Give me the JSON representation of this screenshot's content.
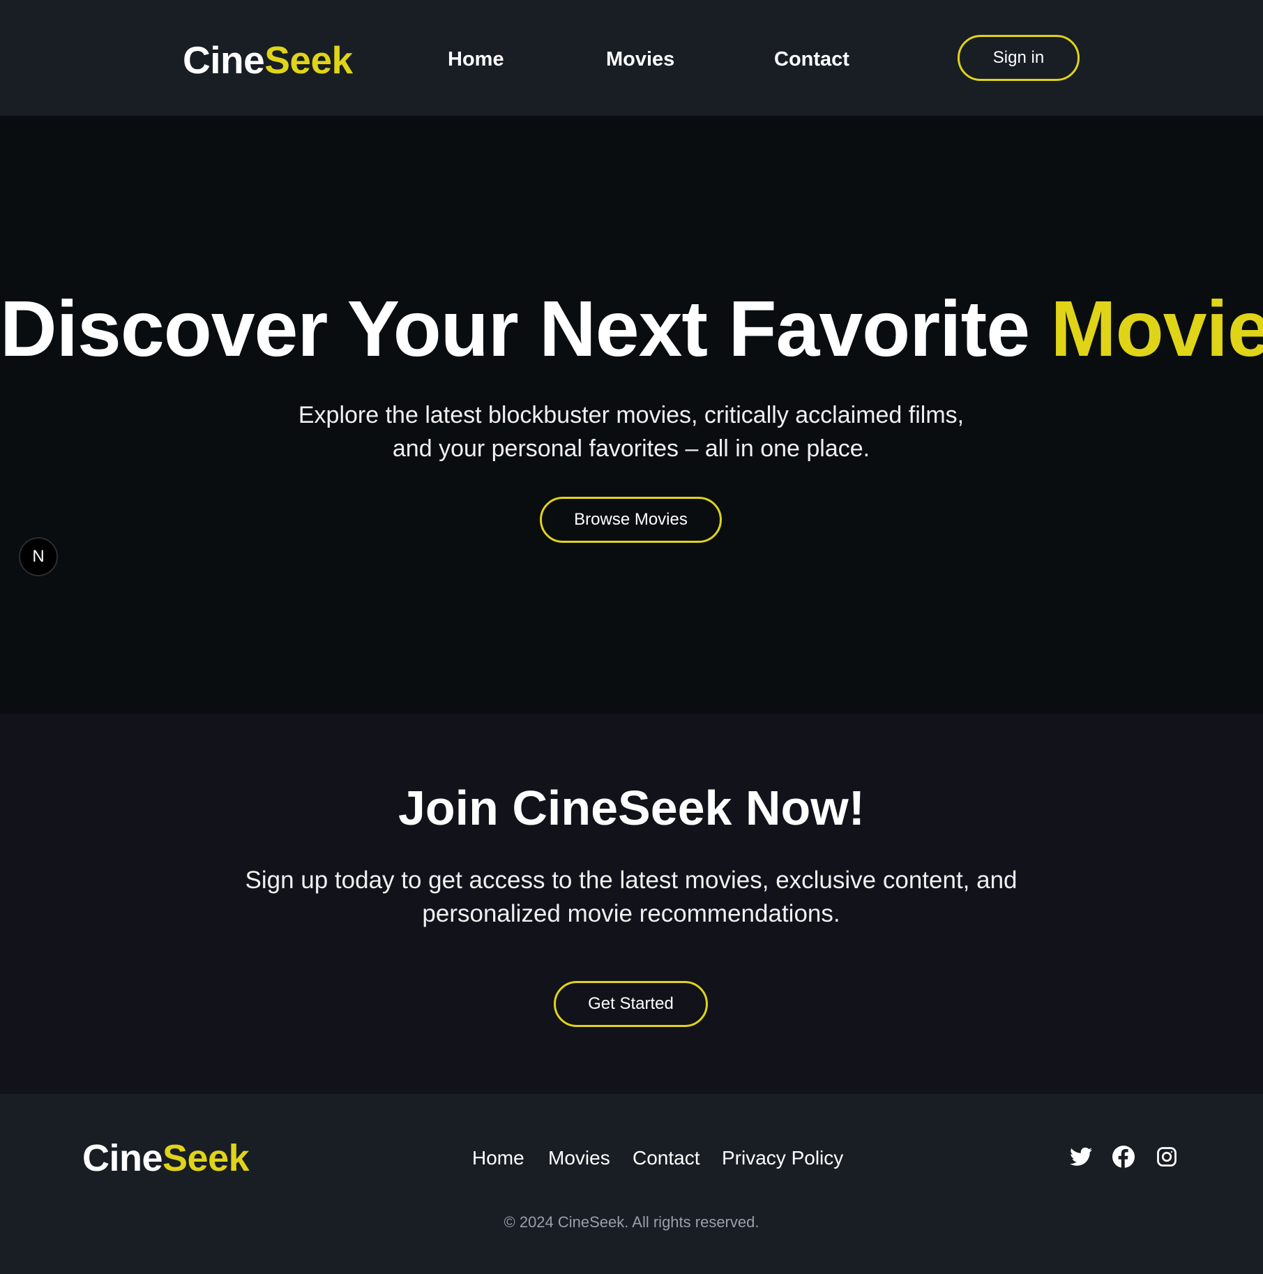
{
  "colors": {
    "accent": "#dfd418",
    "header_bg": "#191d24",
    "hero_bg": "#0a0d10",
    "join_bg": "#12121a",
    "footer_bg": "#191d24"
  },
  "header": {
    "logo_part1": "Cine",
    "logo_part2": "Seek",
    "nav": {
      "home": "Home",
      "movies": "Movies",
      "contact": "Contact"
    },
    "signin_label": "Sign in"
  },
  "hero": {
    "title_main": "Discover Your Next Favorite ",
    "title_highlight": "Movie",
    "subtitle_line1": "Explore the latest blockbuster movies, critically acclaimed films,",
    "subtitle_line2": "and your personal favorites – all in one place.",
    "cta_label": "Browse Movies",
    "badge_letter": "N"
  },
  "join": {
    "title": "Join CineSeek Now!",
    "subtitle_line1": "Sign up today to get access to the latest movies, exclusive content, and",
    "subtitle_line2": "personalized movie recommendations.",
    "cta_label": "Get Started"
  },
  "footer": {
    "logo_part1": "Cine",
    "logo_part2": "Seek",
    "links": {
      "home": "Home",
      "movies": "Movies",
      "contact": "Contact",
      "privacy": "Privacy Policy"
    },
    "social_icons": [
      "twitter-icon",
      "facebook-icon",
      "instagram-icon"
    ],
    "copyright": "© 2024 CineSeek. All rights reserved."
  }
}
